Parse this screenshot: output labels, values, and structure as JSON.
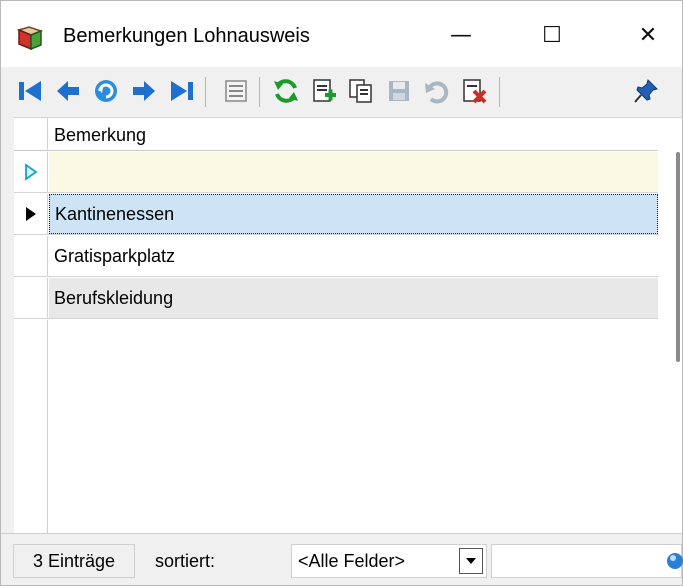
{
  "window": {
    "title": "Bemerkungen Lohnausweis",
    "controls": {
      "minimize": "—",
      "maximize": "☐",
      "close": "✕"
    }
  },
  "toolbar": {
    "items": [
      {
        "name": "first-record",
        "icon": "first-record-icon"
      },
      {
        "name": "previous-record",
        "icon": "previous-record-icon"
      },
      {
        "name": "search",
        "icon": "search-record-icon"
      },
      {
        "name": "next-record",
        "icon": "next-record-icon"
      },
      {
        "name": "last-record",
        "icon": "last-record-icon"
      },
      {
        "name": "list-view",
        "icon": "list-view-icon"
      },
      {
        "name": "refresh",
        "icon": "refresh-icon"
      },
      {
        "name": "new-record",
        "icon": "new-record-icon"
      },
      {
        "name": "copy-record",
        "icon": "copy-record-icon"
      },
      {
        "name": "save",
        "icon": "save-icon"
      },
      {
        "name": "undo",
        "icon": "undo-icon"
      },
      {
        "name": "delete",
        "icon": "delete-icon"
      },
      {
        "name": "pin",
        "icon": "pin-icon"
      }
    ],
    "colors": {
      "nav_blue": "#1f6fd1",
      "refresh_green": "#1a9a2b",
      "delete_red": "#d32b1f",
      "disabled_gray": "#a9b6c4"
    }
  },
  "grid": {
    "column_header": "Bemerkung",
    "rows": [
      {
        "text": "",
        "state": "new"
      },
      {
        "text": "Kantinenessen",
        "state": "selected"
      },
      {
        "text": "Gratisparkplatz",
        "state": "normal"
      },
      {
        "text": "Berufskleidung",
        "state": "alternate"
      }
    ]
  },
  "status": {
    "count": "3 Einträge",
    "sort_label": "sortiert:",
    "sort_value": "<Alle Felder>",
    "filter_value": ""
  }
}
